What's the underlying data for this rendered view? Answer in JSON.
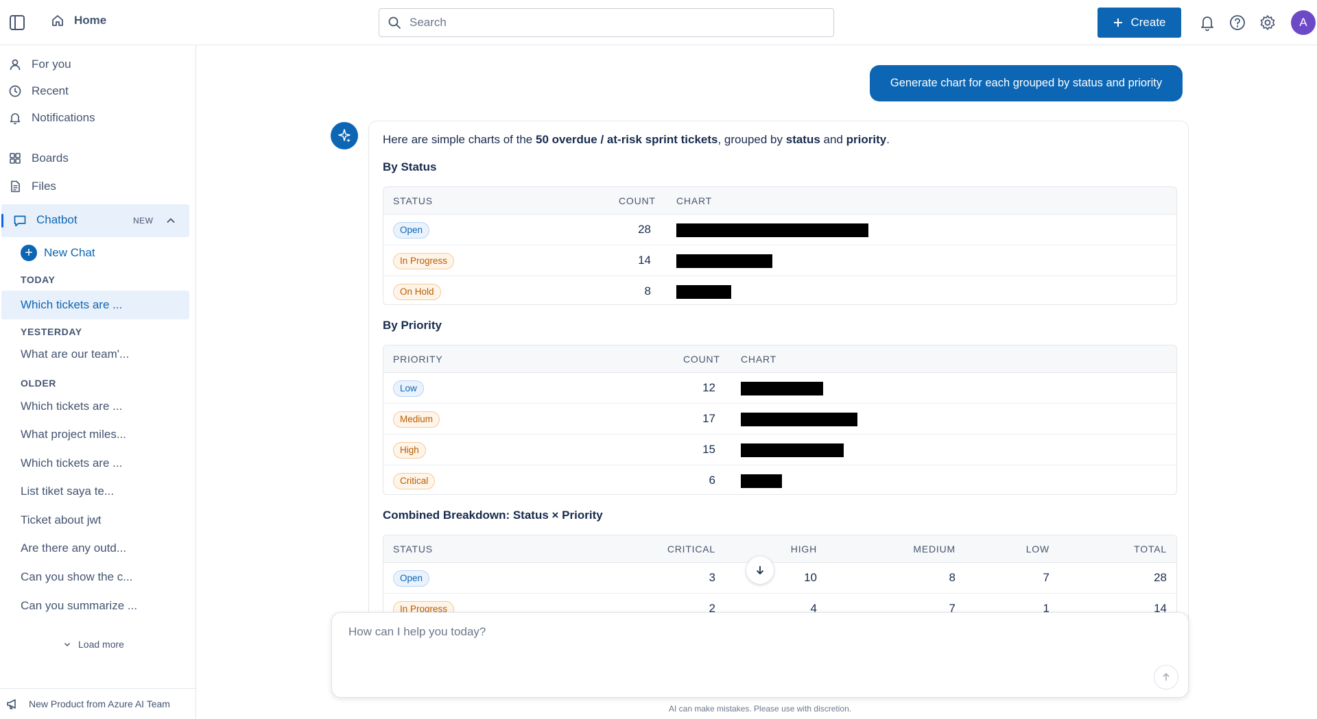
{
  "topbar": {
    "home_label": "Home",
    "search_placeholder": "Search",
    "create_label": "Create",
    "avatar_initial": "A"
  },
  "sidebar": {
    "nav": [
      {
        "label": "For you",
        "icon": "person-icon"
      },
      {
        "label": "Recent",
        "icon": "clock-icon"
      },
      {
        "label": "Notifications",
        "icon": "bell-icon"
      },
      {
        "label": "Boards",
        "icon": "grid-icon"
      },
      {
        "label": "Files",
        "icon": "file-icon"
      }
    ],
    "chatbot_label": "Chatbot",
    "chatbot_badge": "NEW",
    "new_chat_label": "New Chat",
    "groups": {
      "today": "TODAY",
      "yesterday": "YESTERDAY",
      "older": "OLDER"
    },
    "history_today": [
      "Which tickets are ..."
    ],
    "history_yesterday": [
      "What are our team'..."
    ],
    "history_older": [
      "Which tickets are ...",
      "What project miles...",
      "Which tickets are ...",
      "List tiket saya te...",
      "Ticket about jwt",
      "Are there any outd...",
      "Can you show the c...",
      "Can you summarize ..."
    ],
    "load_more": "Load more",
    "footer": "New Product from Azure AI Team"
  },
  "chat": {
    "user_message": "Generate chart for each grouped by status and priority",
    "intro": {
      "p1": "Here are simple charts of the ",
      "b1": "50 overdue / at-risk sprint tickets",
      "p2": ", grouped by ",
      "b2": "status",
      "p3": " and ",
      "b3": "priority",
      "p4": "."
    },
    "by_status": {
      "title": "By Status",
      "headers": [
        "STATUS",
        "COUNT",
        "CHART"
      ],
      "rows": [
        {
          "label": "Open",
          "count": "28",
          "value": 28
        },
        {
          "label": "In Progress",
          "count": "14",
          "value": 14
        },
        {
          "label": "On Hold",
          "count": "8",
          "value": 8
        }
      ]
    },
    "by_priority": {
      "title": "By Priority",
      "headers": [
        "PRIORITY",
        "COUNT",
        "CHART"
      ],
      "rows": [
        {
          "label": "Low",
          "count": "12",
          "value": 12
        },
        {
          "label": "Medium",
          "count": "17",
          "value": 17
        },
        {
          "label": "High",
          "count": "15",
          "value": 15
        },
        {
          "label": "Critical",
          "count": "6",
          "value": 6
        }
      ]
    },
    "combined": {
      "title": "Combined Breakdown: Status × Priority",
      "headers": [
        "STATUS",
        "CRITICAL",
        "HIGH",
        "MEDIUM",
        "LOW",
        "TOTAL"
      ],
      "rows": [
        {
          "label": "Open",
          "values": [
            "3",
            "10",
            "8",
            "7",
            "28"
          ]
        },
        {
          "label": "In Progress",
          "values": [
            "2",
            "4",
            "7",
            "1",
            "14"
          ]
        }
      ]
    }
  },
  "composer": {
    "placeholder": "How can I help you today?"
  },
  "disclaimer": "AI can make mistakes. Please use with discretion.",
  "colors": {
    "brand": "#0c66b4",
    "chart_bar": "#000000"
  }
}
